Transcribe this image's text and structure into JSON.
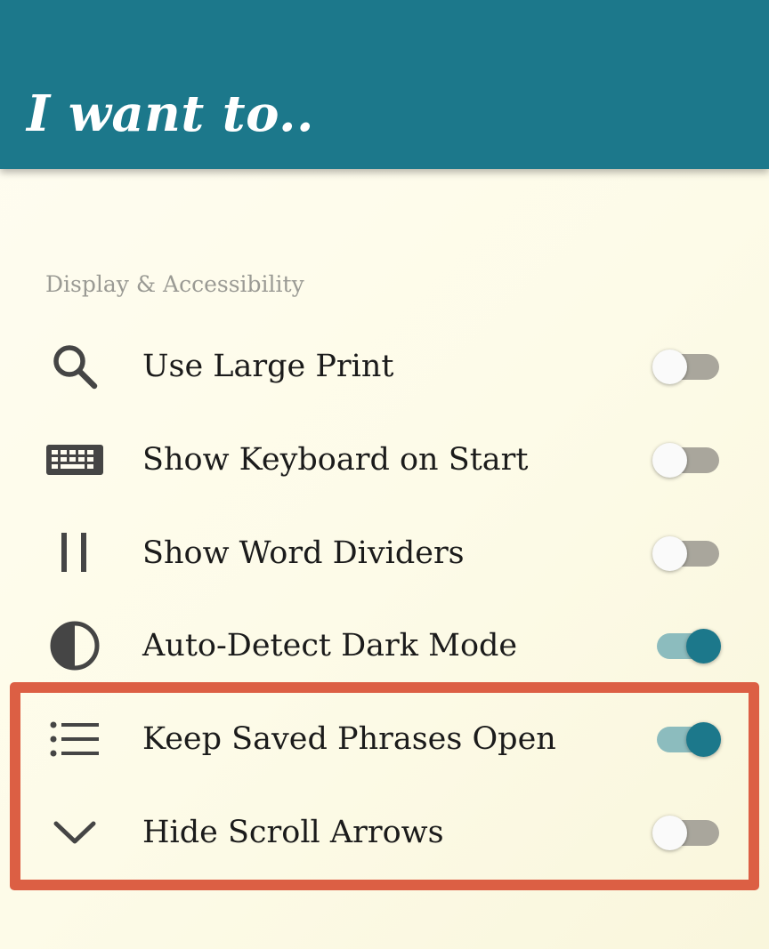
{
  "app_bar": {
    "title": "I want to..",
    "background_color": "#1c788b"
  },
  "section": {
    "header": "Display & Accessibility",
    "items": [
      {
        "label": "Use Large Print",
        "icon": "magnifier-icon",
        "enabled": false
      },
      {
        "label": "Show Keyboard on Start",
        "icon": "keyboard-icon",
        "enabled": false
      },
      {
        "label": "Show Word Dividers",
        "icon": "word-dividers-icon",
        "enabled": false
      },
      {
        "label": "Auto-Detect Dark Mode",
        "icon": "contrast-icon",
        "enabled": true
      },
      {
        "label": "Keep Saved Phrases Open",
        "icon": "list-icon",
        "enabled": true
      },
      {
        "label": "Hide Scroll Arrows",
        "icon": "chevron-down-icon",
        "enabled": false
      }
    ]
  },
  "colors": {
    "accent": "#1c788b",
    "toggle_on_track": "#8cbcbe",
    "toggle_off_track": "#a9a69c",
    "highlight_box": "#dc5f44",
    "section_header_text": "#9a9a94"
  }
}
